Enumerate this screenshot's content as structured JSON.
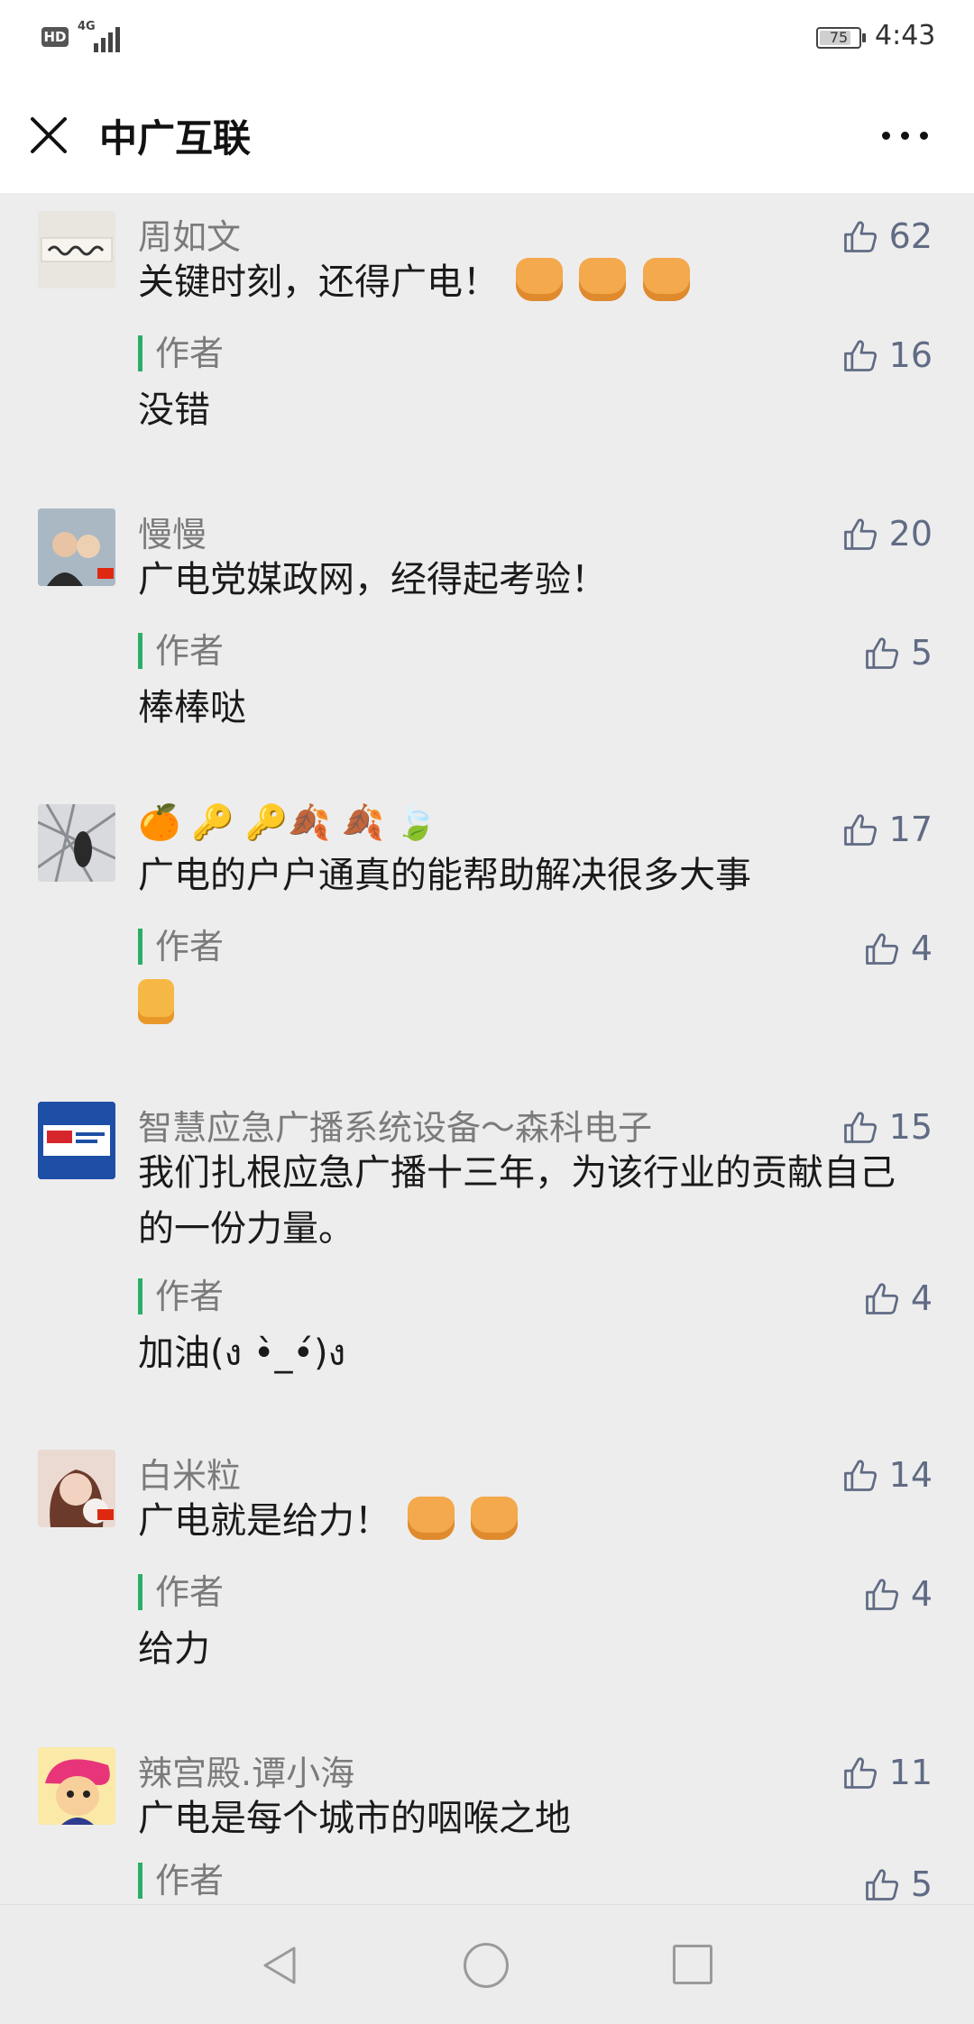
{
  "status_bar": {
    "hd": "HD",
    "network": "4G",
    "battery": "75",
    "time": "4:43"
  },
  "header": {
    "title": "中广互联"
  },
  "comments": [
    {
      "author": "周如文",
      "text": "关键时刻，还得广电！",
      "likes": "62",
      "reply_label": "作者",
      "reply_text": "没错",
      "reply_likes": "16"
    },
    {
      "author": "慢慢",
      "text": "广电党媒政网，经得起考验！",
      "likes": "20",
      "reply_label": "作者",
      "reply_text": "棒棒哒",
      "reply_likes": "5"
    },
    {
      "author": "🍊 🔑 🔑🍂 🍂 🍃",
      "text": "广电的户户通真的能帮助解决很多大事",
      "likes": "17",
      "reply_label": "作者",
      "reply_text": "",
      "reply_likes": "4"
    },
    {
      "author": "智慧应急广播系统设备～森科电子",
      "text": "我们扎根应急广播十三年，为该行业的贡献自己的一份力量。",
      "likes": "15",
      "reply_label": "作者",
      "reply_text": "加油(ง •̀_•́)ง",
      "reply_likes": "4"
    },
    {
      "author": "白米粒",
      "text": "广电就是给力！",
      "likes": "14",
      "reply_label": "作者",
      "reply_text": "给力",
      "reply_likes": "4"
    },
    {
      "author": "辣宫殿.谭小海",
      "text": "广电是每个城市的咽喉之地",
      "likes": "11",
      "reply_label": "作者",
      "reply_likes": "5"
    }
  ]
}
